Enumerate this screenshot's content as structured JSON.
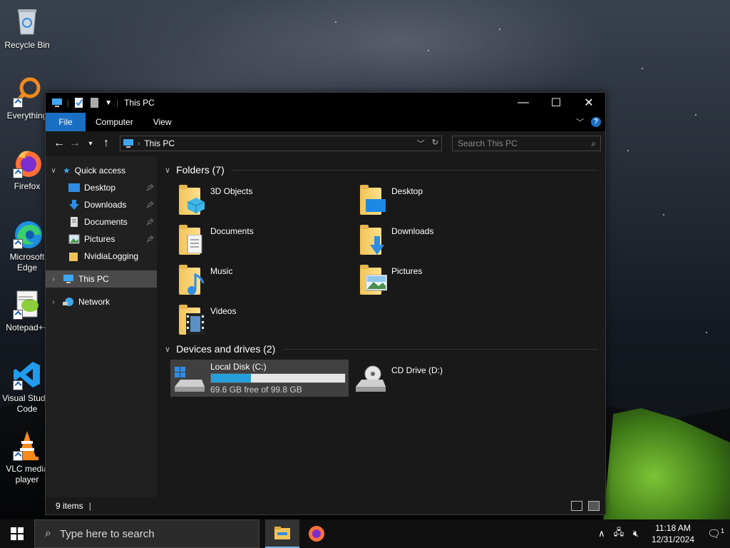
{
  "desktop": {
    "icons": [
      {
        "label": "Recycle Bin"
      },
      {
        "label": "Everything"
      },
      {
        "label": "Firefox"
      },
      {
        "label": "Microsoft Edge"
      },
      {
        "label": "Notepad++"
      },
      {
        "label": "Visual Studio Code"
      },
      {
        "label": "VLC media player"
      }
    ]
  },
  "window": {
    "title": "This PC",
    "ribbon_tabs": [
      "File",
      "Computer",
      "View"
    ],
    "address": "This PC",
    "search_placeholder": "Search This PC",
    "nav": {
      "quick_access": "Quick access",
      "items": [
        "Desktop",
        "Downloads",
        "Documents",
        "Pictures",
        "NvidiaLogging"
      ],
      "this_pc": "This PC",
      "network": "Network"
    },
    "folders_header": "Folders (7)",
    "folders": [
      "3D Objects",
      "Desktop",
      "Documents",
      "Downloads",
      "Music",
      "Pictures",
      "Videos"
    ],
    "drives_header": "Devices and drives (2)",
    "drives": [
      {
        "name": "Local Disk (C:)",
        "free": "69.6 GB free of 99.8 GB",
        "used_fraction": 0.3
      },
      {
        "name": "CD Drive (D:)"
      }
    ],
    "status": "9 items"
  },
  "taskbar": {
    "search_placeholder": "Type here to search",
    "time": "11:18 AM",
    "date": "12/31/2024",
    "notification_count": "1"
  },
  "colors": {
    "accent": "#1a6fc2",
    "selected": "#4a4a4a",
    "drive_bar": "#26a0da"
  }
}
